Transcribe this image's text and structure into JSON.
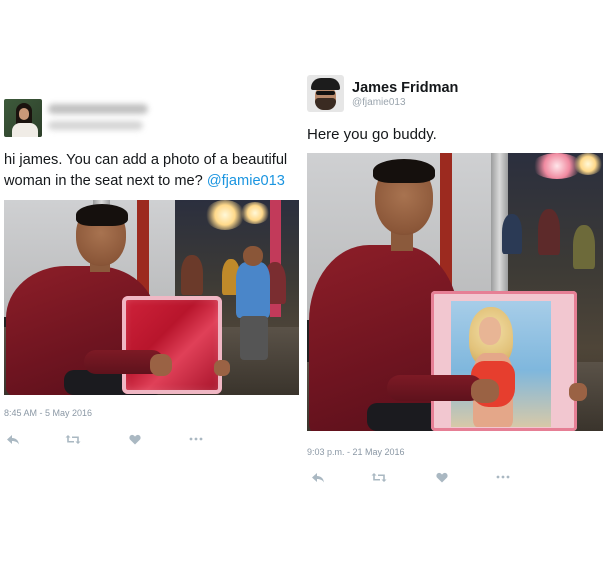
{
  "left_tweet": {
    "text_main": "hi james. You can add a photo of a beautiful woman in the seat next to me? ",
    "mention": "@fjamie013",
    "timestamp": "8:45 AM - 5 May 2016",
    "actions": [
      "reply-icon",
      "retweet-icon",
      "like-icon",
      "more-icon"
    ]
  },
  "right_tweet": {
    "display_name": "James Fridman",
    "handle": "@fjamie013",
    "text": "Here you go buddy.",
    "timestamp": "9:03 p.m. - 21 May 2016",
    "actions": [
      "reply-icon",
      "retweet-icon",
      "like-icon",
      "more-icon"
    ]
  },
  "colors": {
    "mention_blue": "#1b95e0",
    "text_dark": "#14171a",
    "muted_gray": "#8b98a5",
    "icon_gray": "#aab8c2"
  }
}
